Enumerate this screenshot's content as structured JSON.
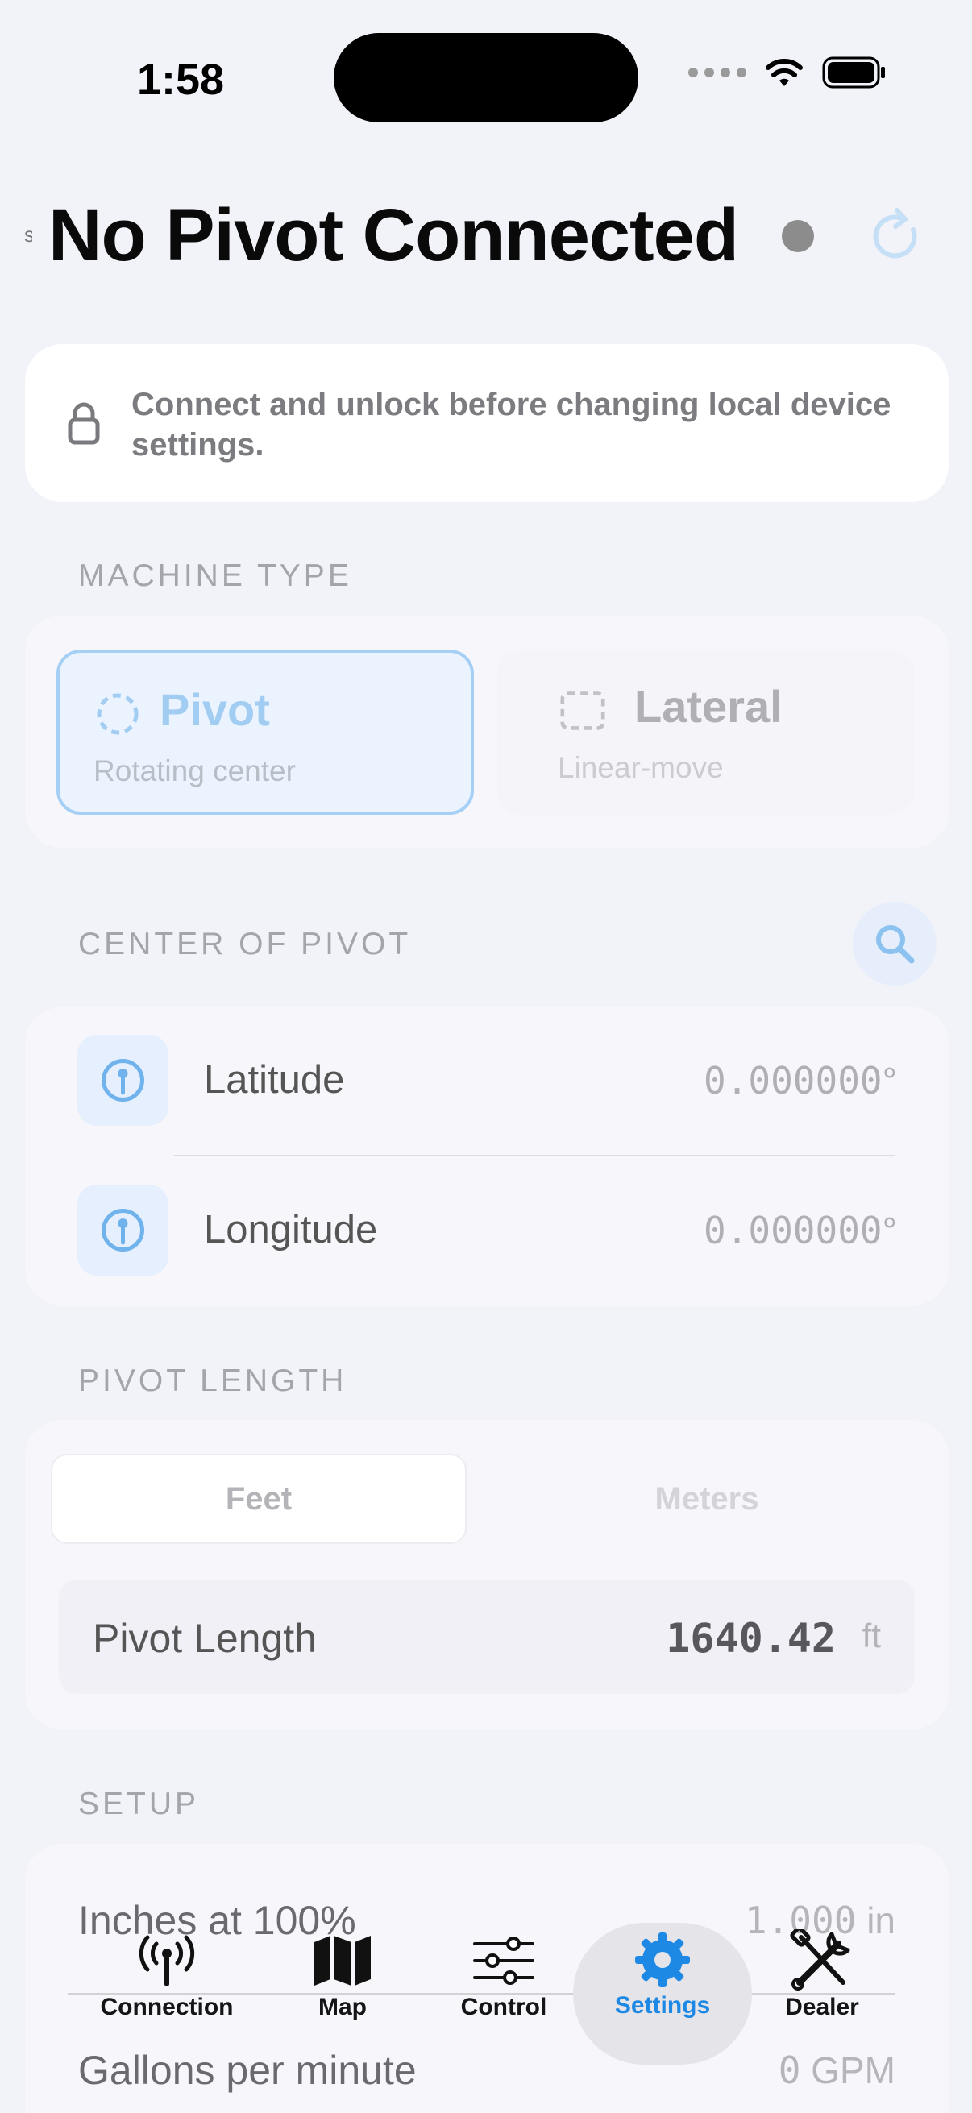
{
  "status_bar": {
    "time": "1:58"
  },
  "header": {
    "title": "No Pivot Connected",
    "connection_status_color": "#8c8c8c",
    "refresh_icon": "refresh-icon"
  },
  "notice": {
    "icon": "lock-icon",
    "text": "Connect and unlock before changing local device settings."
  },
  "machine_type": {
    "section_label": "MACHINE TYPE",
    "options": [
      {
        "name": "Pivot",
        "subtitle": "Rotating center",
        "selected": true
      },
      {
        "name": "Lateral",
        "subtitle": "Linear-move",
        "selected": false
      }
    ]
  },
  "center_of_pivot": {
    "section_label": "CENTER OF PIVOT",
    "rows": [
      {
        "label": "Latitude",
        "value": "0.000000",
        "unit": "°"
      },
      {
        "label": "Longitude",
        "value": "0.000000",
        "unit": "°"
      }
    ]
  },
  "pivot_length": {
    "section_label": "PIVOT LENGTH",
    "units": [
      "Feet",
      "Meters"
    ],
    "selected_unit": "Feet",
    "label": "Pivot Length",
    "value": "1640.42",
    "unit": "ft"
  },
  "setup": {
    "section_label": "SETUP",
    "rows": [
      {
        "label": "Inches at 100%",
        "value": "1.000",
        "unit": "in"
      },
      {
        "label": "Gallons per minute",
        "value": "0",
        "unit": "GPM"
      }
    ]
  },
  "tab_bar": {
    "tabs": [
      {
        "label": "Connection",
        "icon": "antenna-icon"
      },
      {
        "label": "Map",
        "icon": "map-icon"
      },
      {
        "label": "Control",
        "icon": "sliders-icon"
      },
      {
        "label": "Settings",
        "icon": "gear-icon",
        "active": true
      },
      {
        "label": "Dealer",
        "icon": "tools-icon"
      }
    ],
    "active_color": "#1e88e5"
  }
}
